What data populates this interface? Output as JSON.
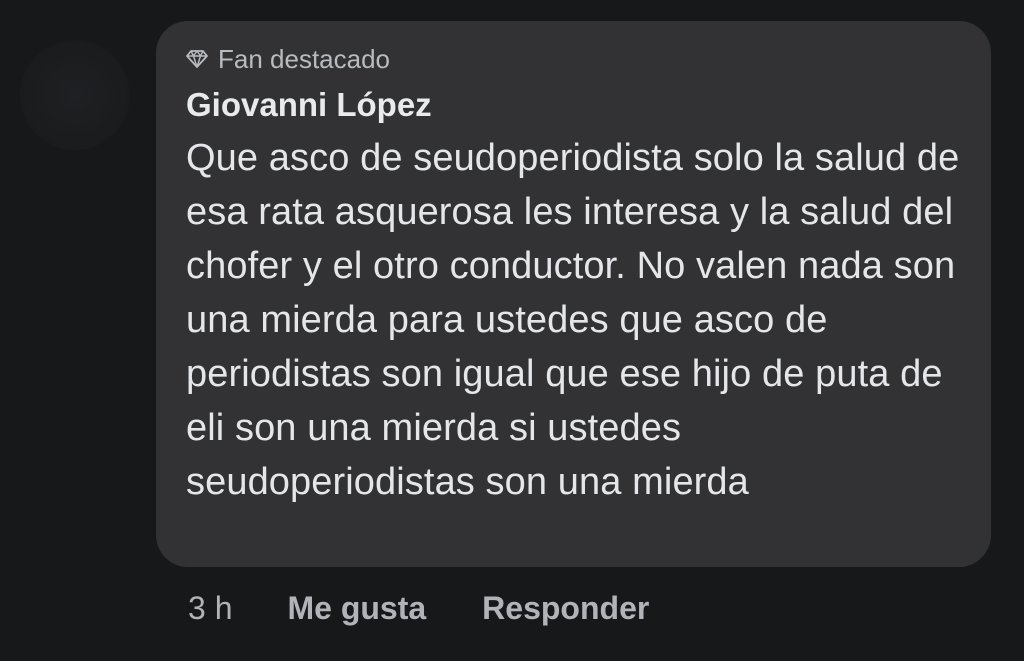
{
  "comment": {
    "badge": {
      "icon": "diamond-icon",
      "label": "Fan destacado"
    },
    "author": "Giovanni López",
    "text": "Que asco de seudoperiodista solo la salud de esa rata asquerosa les interesa y la salud del chofer y el otro conductor. No valen nada son una mierda para ustedes que asco de periodistas son igual que ese hijo de puta de eli son una mierda si ustedes seudoperiodistas son una mierda",
    "timestamp": "3 h",
    "actions": {
      "like_label": "Me gusta",
      "reply_label": "Responder"
    }
  },
  "colors": {
    "background": "#17181a",
    "bubble": "#323234",
    "text_primary": "#e4e6ea",
    "text_secondary": "#b0b3b8"
  }
}
